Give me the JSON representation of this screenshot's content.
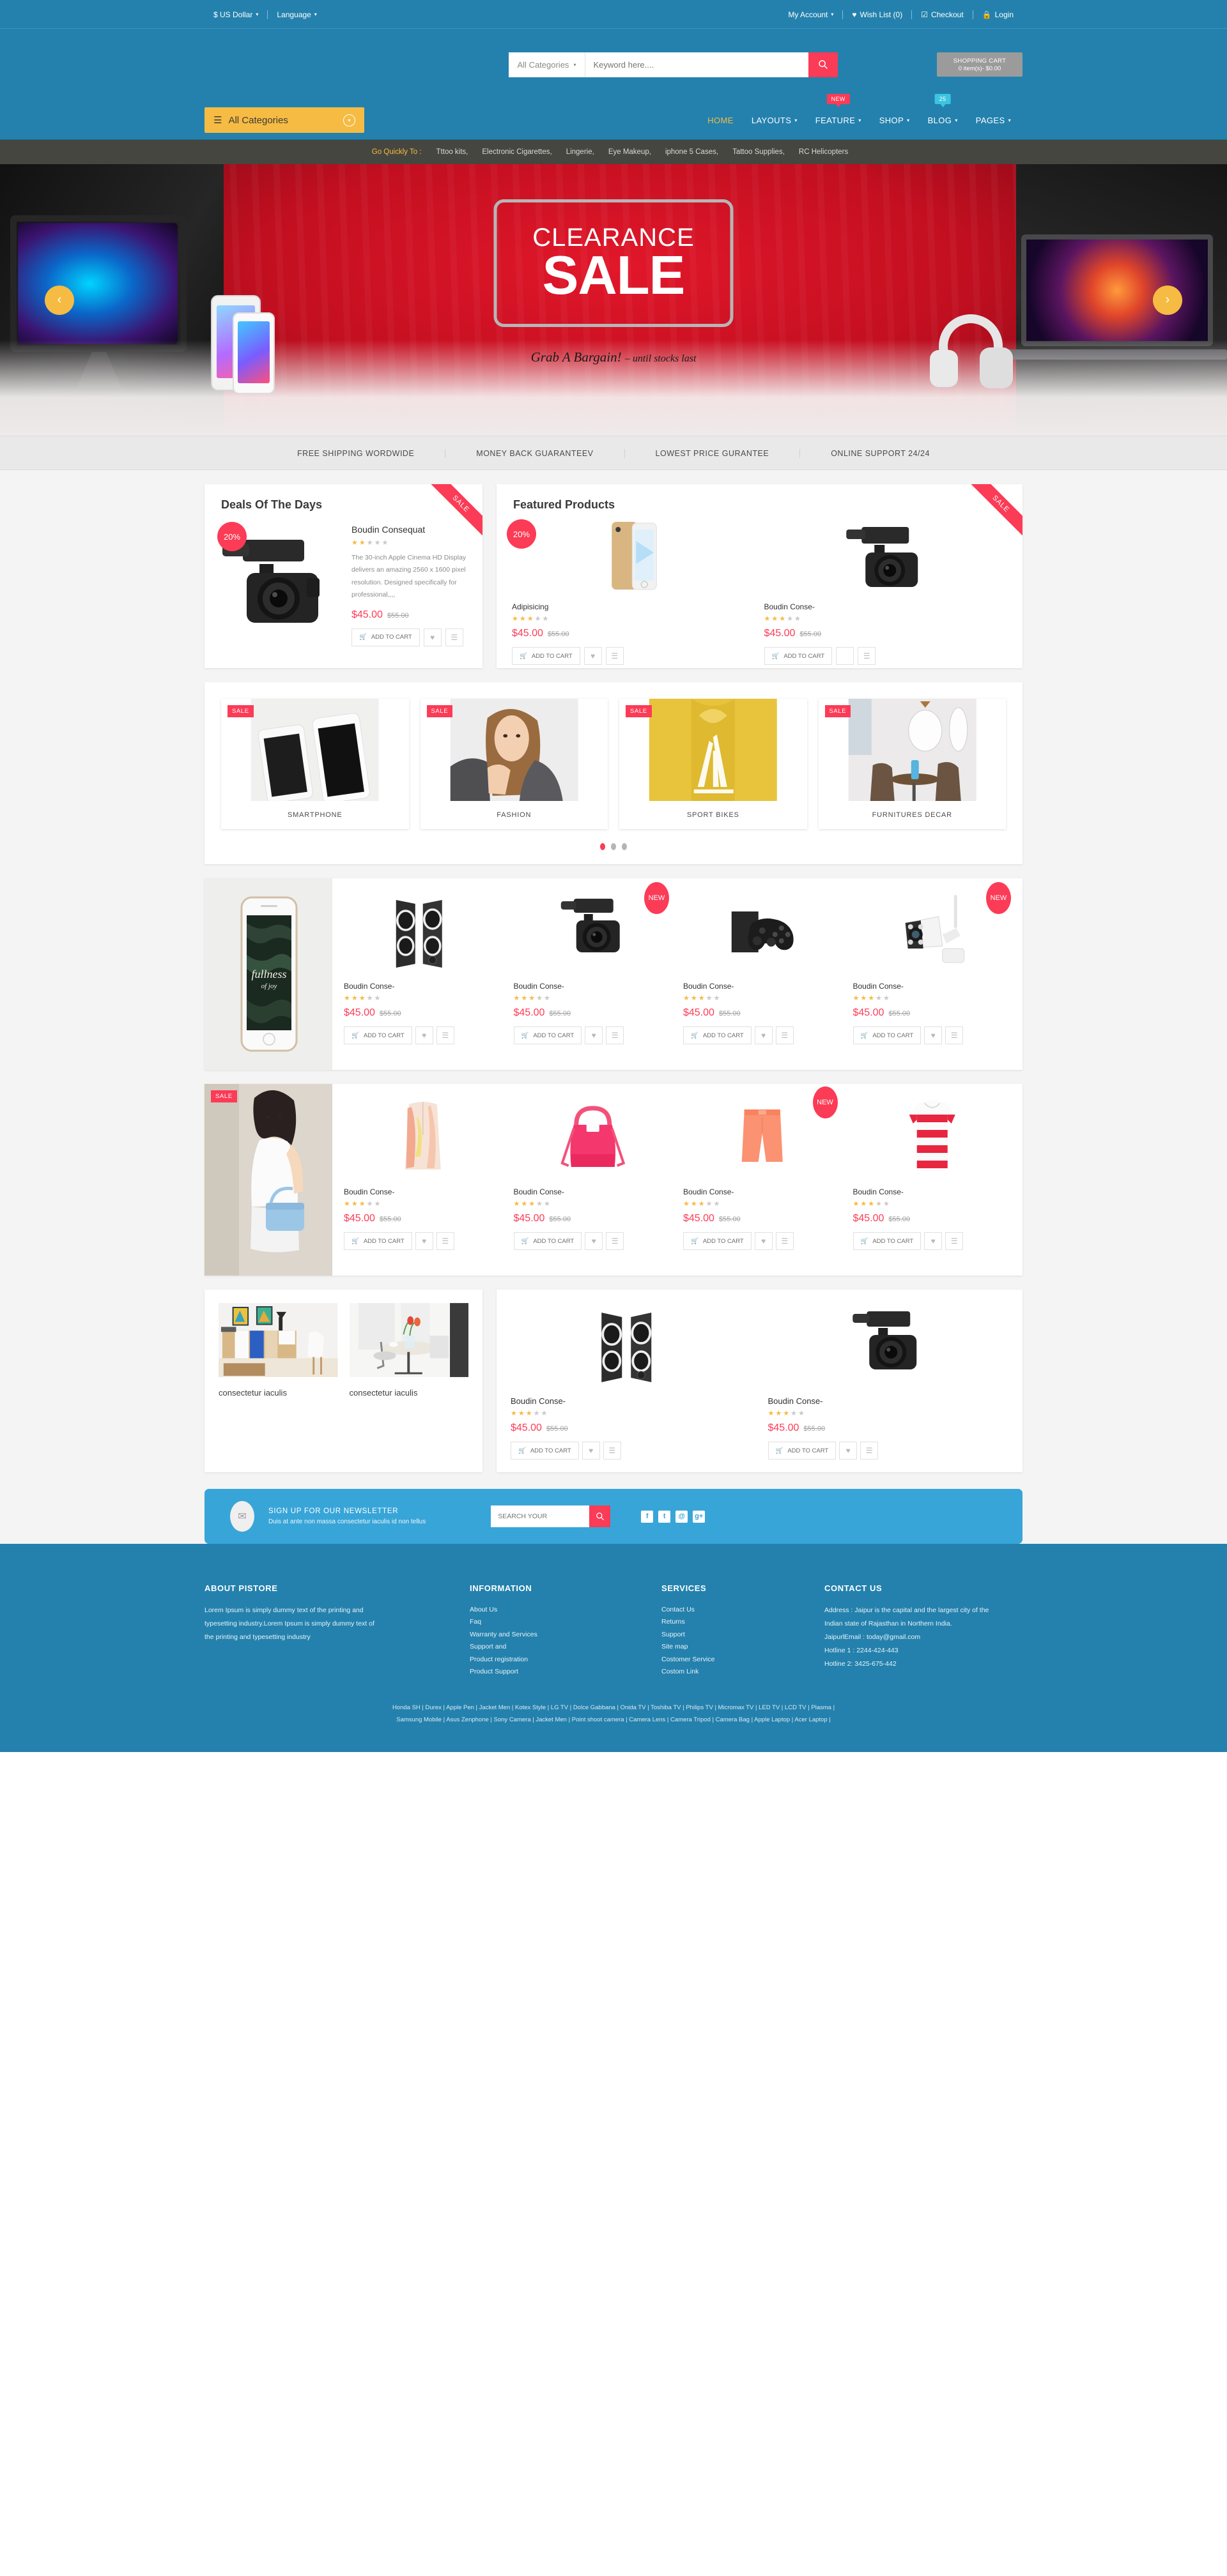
{
  "topbar": {
    "currency": "$ US Dollar",
    "language": "Language",
    "my_account": "My Account",
    "wish_list": "Wish List (0)",
    "checkout": "Checkout",
    "login": "Login"
  },
  "search": {
    "category": "All Categories",
    "placeholder": "Keyword here....",
    "value": ""
  },
  "cart": {
    "title": "SHOPPING CART",
    "summary": "0 item(s)- $0.00"
  },
  "nav": {
    "all_categories": "All Categories",
    "items": [
      {
        "label": "HOME",
        "active": true,
        "caret": false,
        "badge": null
      },
      {
        "label": "LAYOUTS",
        "active": false,
        "caret": true,
        "badge": null
      },
      {
        "label": "FEATURE",
        "active": false,
        "caret": true,
        "badge": "NEW",
        "badge_type": "new"
      },
      {
        "label": "SHOP",
        "active": false,
        "caret": true,
        "badge": null
      },
      {
        "label": "BLOG",
        "active": false,
        "caret": true,
        "badge": "25",
        "badge_type": "count"
      },
      {
        "label": "PAGES",
        "active": false,
        "caret": true,
        "badge": null
      }
    ]
  },
  "quickbar": {
    "label": "Go Quickly To :",
    "links": [
      "Tttoo kits,",
      "Electronic Cigarettes,",
      "Lingerie,",
      "Eye Makeup,",
      "iphone 5 Cases,",
      "Tattoo Supplies,",
      "RC Helicopters"
    ]
  },
  "hero": {
    "line1": "CLEARANCE",
    "line2": "SALE",
    "tagline": "Grab A Bargain!",
    "tagline_sub": "– until stocks last",
    "prev": "‹",
    "next": "›"
  },
  "services": [
    "FREE SHIPPING WORDWIDE",
    "MONEY BACK GUARANTEEV",
    "LOWEST PRICE GURANTEE",
    "ONLINE SUPPORT 24/24"
  ],
  "deals": {
    "title": "Deals Of The Days",
    "ribbon": "SALE",
    "discount": "20%",
    "product": {
      "name": "Boudin Consequat",
      "rating": 2,
      "rating_max": 5,
      "description": "The 30-inch Apple Cinema HD Display delivers an amazing 2560 x 1600 pixel resolution. Designed specifically for professional,,,,",
      "price": "$45.00",
      "old_price": "$55.00",
      "add_to_cart": "ADD TO CART"
    }
  },
  "featured": {
    "title": "Featured Products",
    "ribbon": "SALE",
    "discount": "20%",
    "products": [
      {
        "name": "Adipisicing",
        "rating": 3,
        "price": "$45.00",
        "old_price": "$55.00",
        "add_to_cart": "ADD TO CART",
        "image": "gold-phone"
      },
      {
        "name": "Boudin Conse-",
        "rating": 3,
        "price": "$45.00",
        "old_price": "$55.00",
        "add_to_cart": "ADD TO CART",
        "image": "dslr-camera"
      }
    ]
  },
  "categories": {
    "cards": [
      {
        "label": "SMARTPHONE",
        "tag": "SALE",
        "image": "smartphones-on-marble"
      },
      {
        "label": "FASHION",
        "tag": "SALE",
        "image": "fashion-model"
      },
      {
        "label": "SPORT BIKES",
        "tag": "SALE",
        "image": "yellow-adidas-hoodie"
      },
      {
        "label": "FURNITURES DECAR",
        "tag": "SALE",
        "image": "dining-room-decor"
      }
    ],
    "dots": 3,
    "active_dot": 0
  },
  "electronics_row": {
    "banner_image": "iphone-fullness-of-joy",
    "products": [
      {
        "name": "Boudin Conse-",
        "rating": 3,
        "price": "$45.00",
        "old_price": "$55.00",
        "add_to_cart": "ADD TO CART",
        "badge": null,
        "image": "black-speakers"
      },
      {
        "name": "Boudin Conse-",
        "rating": 3,
        "price": "$45.00",
        "old_price": "$55.00",
        "add_to_cart": "ADD TO CART",
        "badge": "NEW",
        "image": "dslr-camera"
      },
      {
        "name": "Boudin Conse-",
        "rating": 3,
        "price": "$45.00",
        "old_price": "$55.00",
        "add_to_cart": "ADD TO CART",
        "badge": null,
        "image": "game-controller"
      },
      {
        "name": "Boudin Conse-",
        "rating": 3,
        "price": "$45.00",
        "old_price": "$55.00",
        "add_to_cart": "ADD TO CART",
        "badge": "NEW",
        "image": "security-camera"
      }
    ]
  },
  "fashion_row": {
    "banner_image": "woman-with-blue-handbag",
    "banner_tag": "SALE",
    "products": [
      {
        "name": "Boudin Conse-",
        "rating": 3,
        "price": "$45.00",
        "old_price": "$55.00",
        "add_to_cart": "ADD TO CART",
        "badge": null,
        "image": "floral-vest"
      },
      {
        "name": "Boudin Conse-",
        "rating": 3,
        "price": "$45.00",
        "old_price": "$55.00",
        "add_to_cart": "ADD TO CART",
        "badge": null,
        "image": "pink-handbag"
      },
      {
        "name": "Boudin Conse-",
        "rating": 3,
        "price": "$45.00",
        "old_price": "$55.00",
        "add_to_cart": "ADD TO CART",
        "badge": "NEW",
        "image": "coral-shorts"
      },
      {
        "name": "Boudin Conse-",
        "rating": 3,
        "price": "$45.00",
        "old_price": "$55.00",
        "add_to_cart": "ADD TO CART",
        "badge": null,
        "image": "striped-top"
      }
    ]
  },
  "blog": {
    "posts": [
      {
        "title": "consectetur iaculis",
        "image": "shelf-with-art"
      },
      {
        "title": "consectetur iaculis",
        "image": "dining-table-tulips"
      }
    ]
  },
  "special": {
    "products": [
      {
        "name": "Boudin Conse-",
        "rating": 3,
        "price": "$45.00",
        "old_price": "$55.00",
        "add_to_cart": "ADD TO CART",
        "image": "black-speakers"
      },
      {
        "name": "Boudin Conse-",
        "rating": 3,
        "price": "$45.00",
        "old_price": "$55.00",
        "add_to_cart": "ADD TO CART",
        "image": "dslr-camera"
      }
    ]
  },
  "newsletter": {
    "title": "SIGN UP FOR OUR NEWSLETTER",
    "subtitle": "Duis at ante non massa consectetur iaculis id non tellus",
    "placeholder": "SEARCH YOUR",
    "value": "",
    "socials": [
      "f",
      "t",
      "@",
      "g+"
    ]
  },
  "footer": {
    "about": {
      "heading": "ABOUT PISTORE",
      "text": "Lorem Ipsum is simply dummy text of the printing and typesetting industry.Lorem Ipsum is simply dummy text of the printing and typesetting industry"
    },
    "information": {
      "heading": "INFORMATION",
      "links": [
        "About Us",
        "Faq",
        "Warranty and Services",
        "Support and",
        "Product registration",
        "Product Support"
      ]
    },
    "services": {
      "heading": "SERVICES",
      "links": [
        "Contact Us",
        "Returns",
        "Support",
        "Site map",
        "Costomer Service",
        "Costom Link"
      ]
    },
    "contact": {
      "heading": "CONTACT US",
      "address": "Address : Jaipur is the capital and the largest city of the Indian state of Rajasthan in Northern India.",
      "email": "JaipurlEmail : today@gmail.com",
      "hotline1": "Hotline 1 : 2244-424-443",
      "hotline2": "Hotline 2: 3425-675-442"
    },
    "brand_line_1": "Honda SH | Durex | Apple Pen | Jacket Men | Kotex Style | LG TV | Dolce Gabbana | Onida TV | Toshiba TV | Philips TV | Micromax TV | LED TV | LCD TV | Plasma |",
    "brand_line_2": "Samsung Mobile | Asus Zenphone | Sony Camera | Jacket Men | Point shoot camera | Camera Lens | Camera Tripod | Camera Bag | Apple Laptop | Acer Laptop |"
  },
  "icons": {
    "search": "⚲",
    "heart": "♥",
    "cart": "⛒",
    "compare": "≣",
    "mail": "✉",
    "list": "☰",
    "caret": "▾"
  }
}
